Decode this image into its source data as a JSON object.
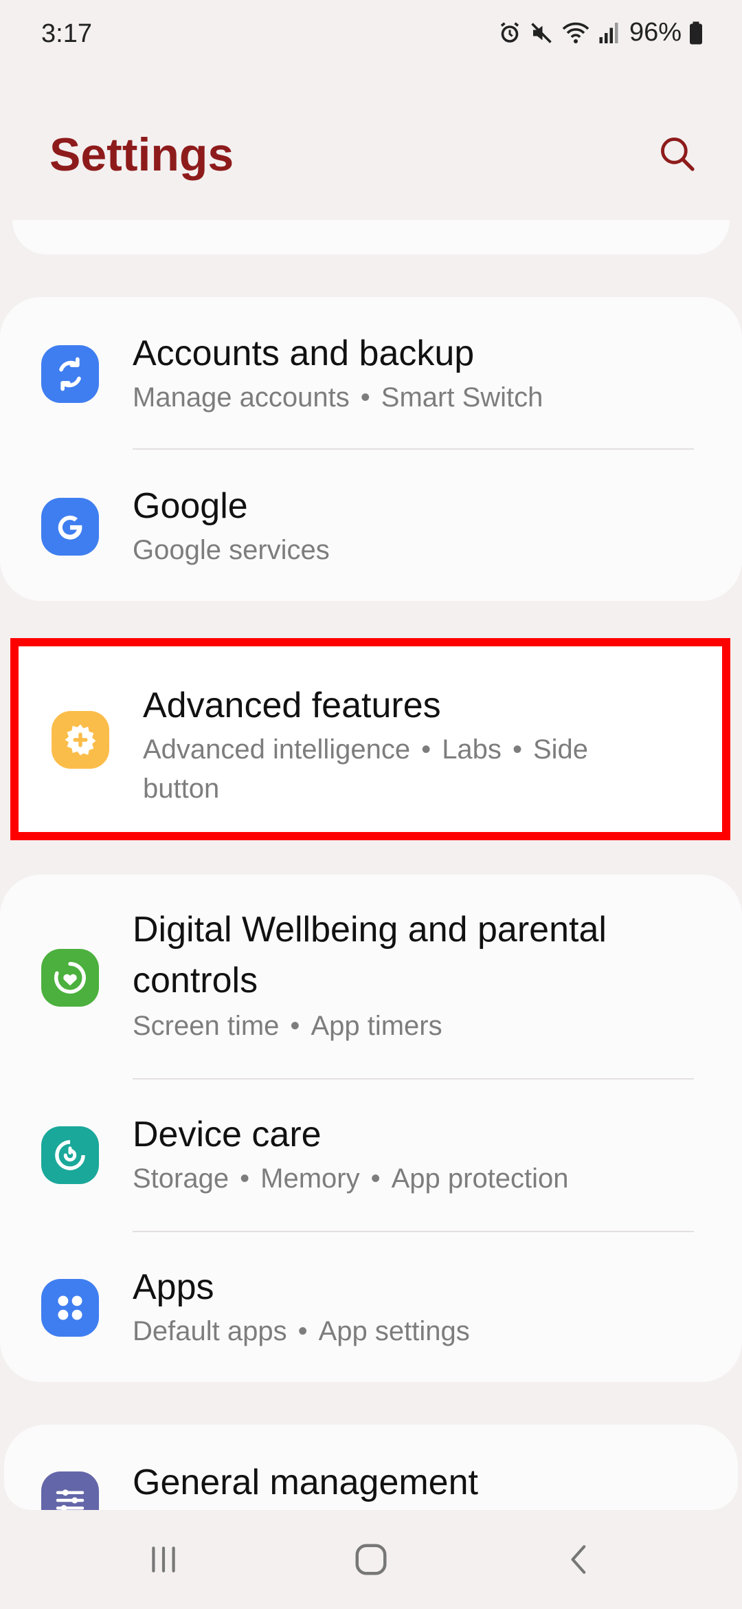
{
  "status_bar": {
    "time": "3:17",
    "battery_percent": "96%",
    "icons": [
      "alarm-icon",
      "mute-icon",
      "wifi-icon",
      "signal-icon",
      "battery-icon"
    ]
  },
  "header": {
    "title": "Settings",
    "search_icon": "search-icon"
  },
  "colors": {
    "title": "#8e1b1b",
    "background": "#f4f0f0",
    "card": "#fcfbfb",
    "highlight": "#ff0000"
  },
  "groups": [
    {
      "items": [
        {
          "title": "Accounts and backup",
          "subtitle": [
            "Manage accounts",
            "Smart Switch"
          ],
          "icon": "sync-icon",
          "icon_color": "#3f7ef0"
        },
        {
          "title": "Google",
          "subtitle": [
            "Google services"
          ],
          "icon": "google-icon",
          "icon_color": "#3f7ef0"
        }
      ]
    },
    {
      "items": [
        {
          "title": "Advanced features",
          "subtitle_line1": [
            "Advanced intelligence",
            "Labs",
            "Side"
          ],
          "subtitle_line2": "button",
          "icon": "gear-plus-icon",
          "icon_color": "#fbbd4a"
        }
      ]
    },
    {
      "items": [
        {
          "title_line1": "Digital Wellbeing and parental",
          "title_line2": "controls",
          "subtitle": [
            "Screen time",
            "App timers"
          ],
          "icon": "wellbeing-icon",
          "icon_color": "#4bb03d"
        },
        {
          "title": "Device care",
          "subtitle": [
            "Storage",
            "Memory",
            "App protection"
          ],
          "icon": "device-care-icon",
          "icon_color": "#1aa89a"
        },
        {
          "title": "Apps",
          "subtitle": [
            "Default apps",
            "App settings"
          ],
          "icon": "apps-grid-icon",
          "icon_color": "#3f7ef0"
        }
      ]
    },
    {
      "items": [
        {
          "title": "General management",
          "icon": "sliders-icon",
          "icon_color": "#6366a8"
        }
      ]
    }
  ],
  "nav": {
    "recents_icon": "recents-icon",
    "home_icon": "home-icon",
    "back_icon": "back-icon"
  }
}
